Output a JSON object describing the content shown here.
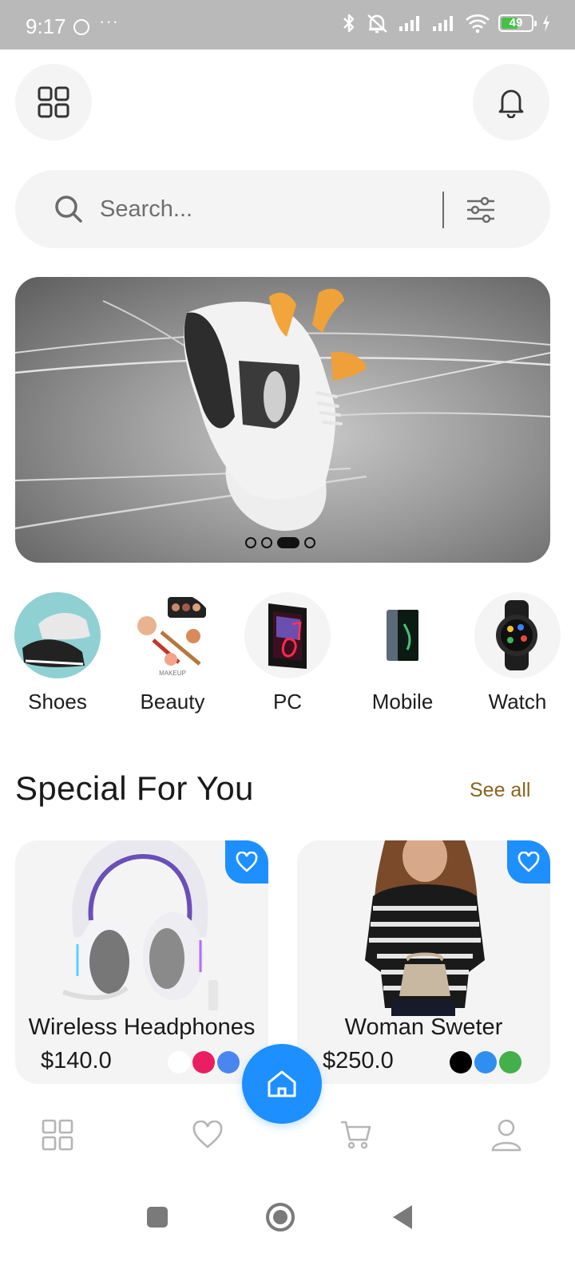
{
  "status_bar": {
    "time": "9:17",
    "dots": "···",
    "battery_level": "49",
    "icons": [
      "face-icon",
      "bluetooth-icon",
      "mute-icon",
      "signal-icon",
      "signal-icon",
      "wifi-icon",
      "battery-icon",
      "charging-icon"
    ]
  },
  "header": {
    "menu_icon": "grid-icon",
    "notification_icon": "bell-icon"
  },
  "search": {
    "placeholder": "Search...",
    "value": "",
    "filter_icon": "sliders-icon"
  },
  "banner": {
    "image": "sneaker-promo",
    "slide_count": 4,
    "active_slide": 3
  },
  "categories": [
    {
      "label": "Shoes",
      "icon": "shoes-image"
    },
    {
      "label": "Beauty",
      "icon": "makeup-image"
    },
    {
      "label": "PC",
      "icon": "pc-image"
    },
    {
      "label": "Mobile",
      "icon": "phone-image"
    },
    {
      "label": "Watch",
      "icon": "watch-image"
    }
  ],
  "beauty_caption": "MAKEUP",
  "special": {
    "title": "Special For You",
    "see_all": "See all"
  },
  "products": [
    {
      "name": "Wireless Headphones",
      "price": "$140.0",
      "colors": [
        "#ffffff",
        "#e91e63",
        "#4a86f0"
      ]
    },
    {
      "name": "Woman Sweter",
      "price": "$250.0",
      "colors": [
        "#000000",
        "#2f8ff0",
        "#43b04a"
      ]
    }
  ],
  "theme": {
    "accent": "#1e8fff",
    "surface": "#f4f4f4",
    "see_all_color": "#8a6320"
  },
  "bottom_nav": {
    "items": [
      "grid-icon",
      "heart-icon",
      "home-icon",
      "cart-icon",
      "user-icon"
    ],
    "active": "home-icon"
  }
}
